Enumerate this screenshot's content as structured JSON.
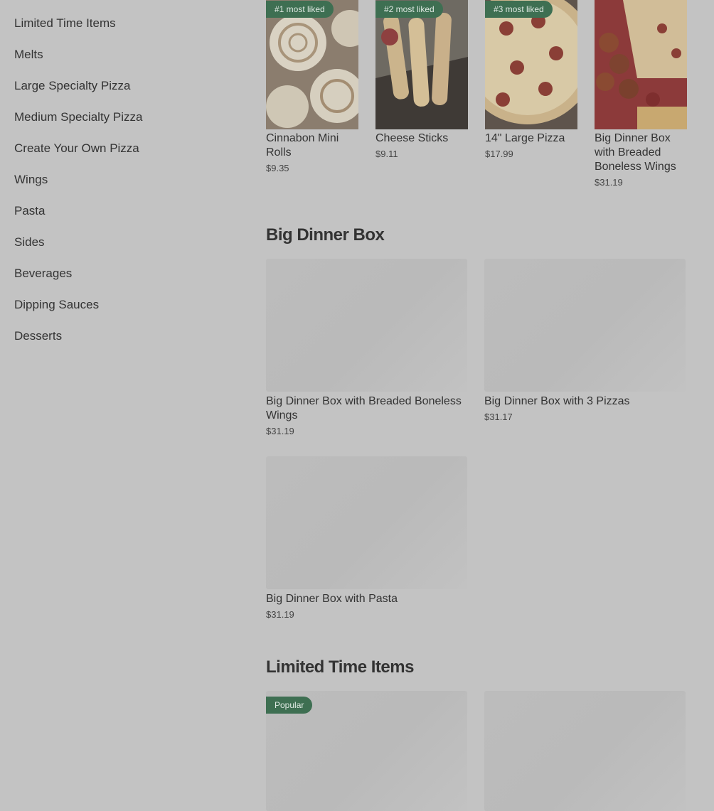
{
  "sidebar": {
    "items": [
      "Limited Time Items",
      "Melts",
      "Large Specialty Pizza",
      "Medium Specialty Pizza",
      "Create Your Own Pizza",
      "Wings",
      "Pasta",
      "Sides",
      "Beverages",
      "Dipping Sauces",
      "Desserts"
    ]
  },
  "most_liked": [
    {
      "badge": "#1 most liked",
      "name": "Cinnabon Mini Rolls",
      "price": "$9.35"
    },
    {
      "badge": "#2 most liked",
      "name": "Cheese Sticks",
      "price": "$9.11"
    },
    {
      "badge": "#3 most liked",
      "name": "14\" Large Pizza",
      "price": "$17.99"
    },
    {
      "badge": "",
      "name": "Big Dinner Box with Breaded Boneless Wings",
      "price": "$31.19"
    }
  ],
  "big_dinner_box": {
    "title": "Big Dinner Box",
    "items": [
      {
        "name": "Big Dinner Box with Breaded Boneless Wings",
        "price": "$31.19"
      },
      {
        "name": "Big Dinner Box with 3 Pizzas",
        "price": "$31.17"
      },
      {
        "name": "Big Dinner Box with Pasta",
        "price": "$31.19"
      }
    ]
  },
  "limited_time": {
    "title": "Limited Time Items",
    "badge": "Popular"
  },
  "colors": {
    "overlay_bg": "#c3c3c3",
    "badge_green": "#3e6f52"
  }
}
